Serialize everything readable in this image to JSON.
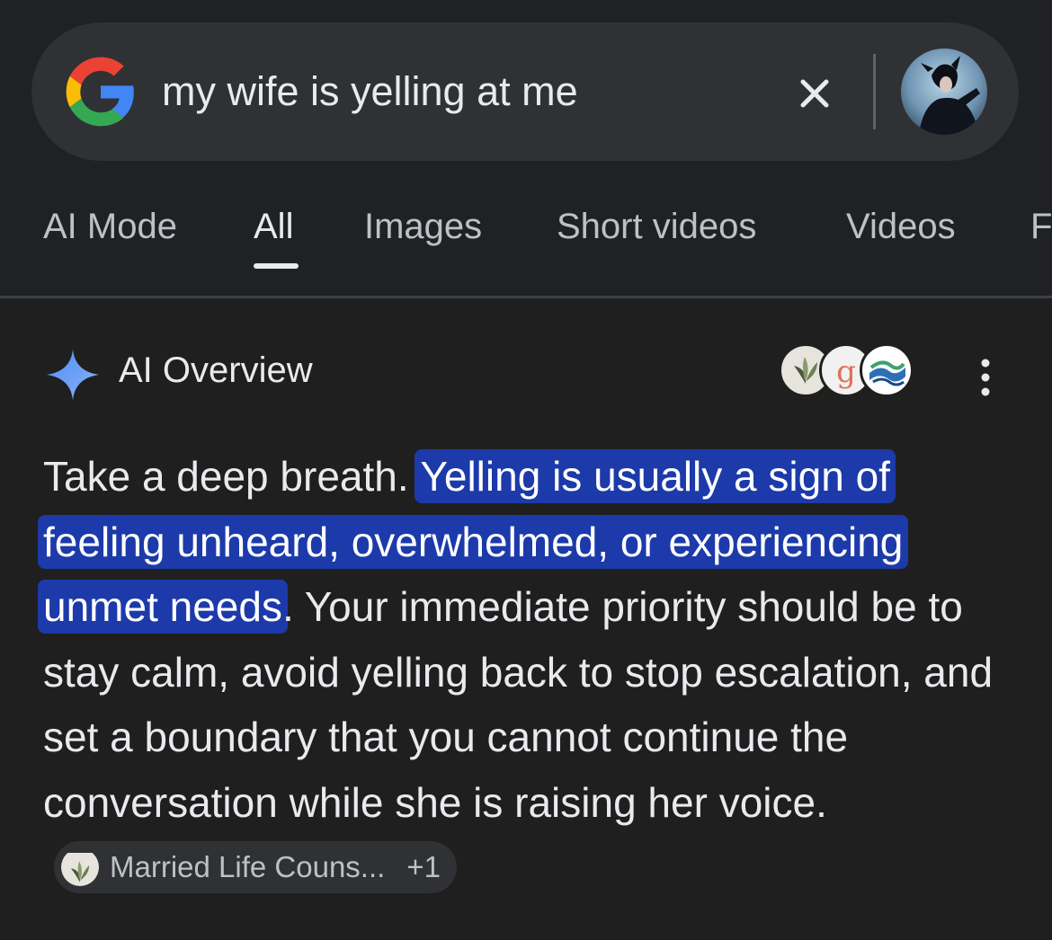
{
  "search": {
    "query": "my wife is yelling at me",
    "clear_icon": "close-icon",
    "avatar_icon": "profile-avatar"
  },
  "tabs": [
    {
      "label": "AI Mode",
      "active": false
    },
    {
      "label": "All",
      "active": true
    },
    {
      "label": "Images",
      "active": false
    },
    {
      "label": "Short videos",
      "active": false
    },
    {
      "label": "Videos",
      "active": false
    },
    {
      "label": "Fo",
      "active": false
    }
  ],
  "ai_overview": {
    "title": "AI Overview",
    "icon": "sparkle-icon",
    "source_icons": [
      "married-life-icon",
      "g-source-icon",
      "wave-source-icon"
    ],
    "more_icon": "more-vert-icon",
    "text_intro": "Take a deep breath. ",
    "text_highlight": "Yelling is usually a sign of feeling unheard, overwhelmed, or experiencing unmet needs",
    "text_rest": ". Your immediate priority should be to stay calm, avoid yelling back to stop escalation, and set a boundary that you cannot continue the conversation while she is raising her voice.",
    "citation": {
      "label": "Married Life Couns...",
      "more": "+1",
      "icon": "married-life-icon"
    }
  },
  "colors": {
    "background": "#1f1f1f",
    "highlight": "#1c3aa9",
    "text": "#e8eaed",
    "secondary_text": "#bdc1c6"
  }
}
